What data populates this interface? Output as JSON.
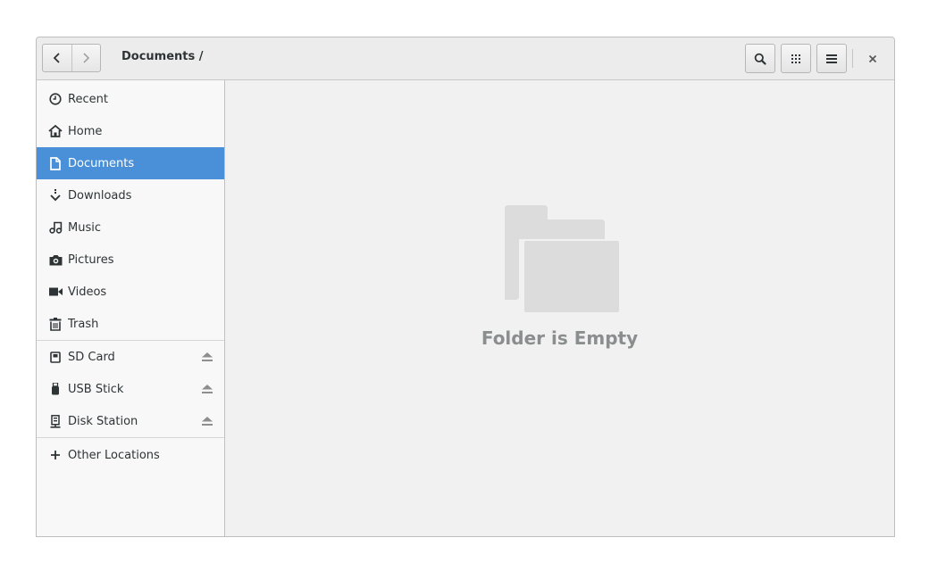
{
  "header": {
    "breadcrumb": "Documents /",
    "back_icon": "chevron-left-icon",
    "forward_icon": "chevron-right-icon",
    "search_icon": "search-icon",
    "grid_icon": "grid-view-icon",
    "menu_icon": "hamburger-menu-icon",
    "close_icon": "close-icon"
  },
  "sidebar": {
    "places": [
      {
        "label": "Recent",
        "icon": "clock-icon"
      },
      {
        "label": "Home",
        "icon": "home-icon"
      },
      {
        "label": "Documents",
        "icon": "document-icon",
        "selected": true
      },
      {
        "label": "Downloads",
        "icon": "download-icon"
      },
      {
        "label": "Music",
        "icon": "music-icon"
      },
      {
        "label": "Pictures",
        "icon": "camera-icon"
      },
      {
        "label": "Videos",
        "icon": "video-icon"
      },
      {
        "label": "Trash",
        "icon": "trash-icon"
      }
    ],
    "devices": [
      {
        "label": "SD Card",
        "icon": "sd-card-icon",
        "eject_icon": "eject-icon"
      },
      {
        "label": "USB Stick",
        "icon": "usb-stick-icon",
        "eject_icon": "eject-icon"
      },
      {
        "label": "Disk Station",
        "icon": "network-server-icon",
        "eject_icon": "eject-icon"
      }
    ],
    "other": {
      "label": "Other Locations",
      "icon": "plus-icon"
    }
  },
  "main": {
    "empty_icon": "folder-icon",
    "empty_message": "Folder is Empty"
  },
  "colors": {
    "selection": "#4a90d9",
    "empty_text": "#8a8e8e",
    "empty_folder": "#dcdcdc"
  }
}
